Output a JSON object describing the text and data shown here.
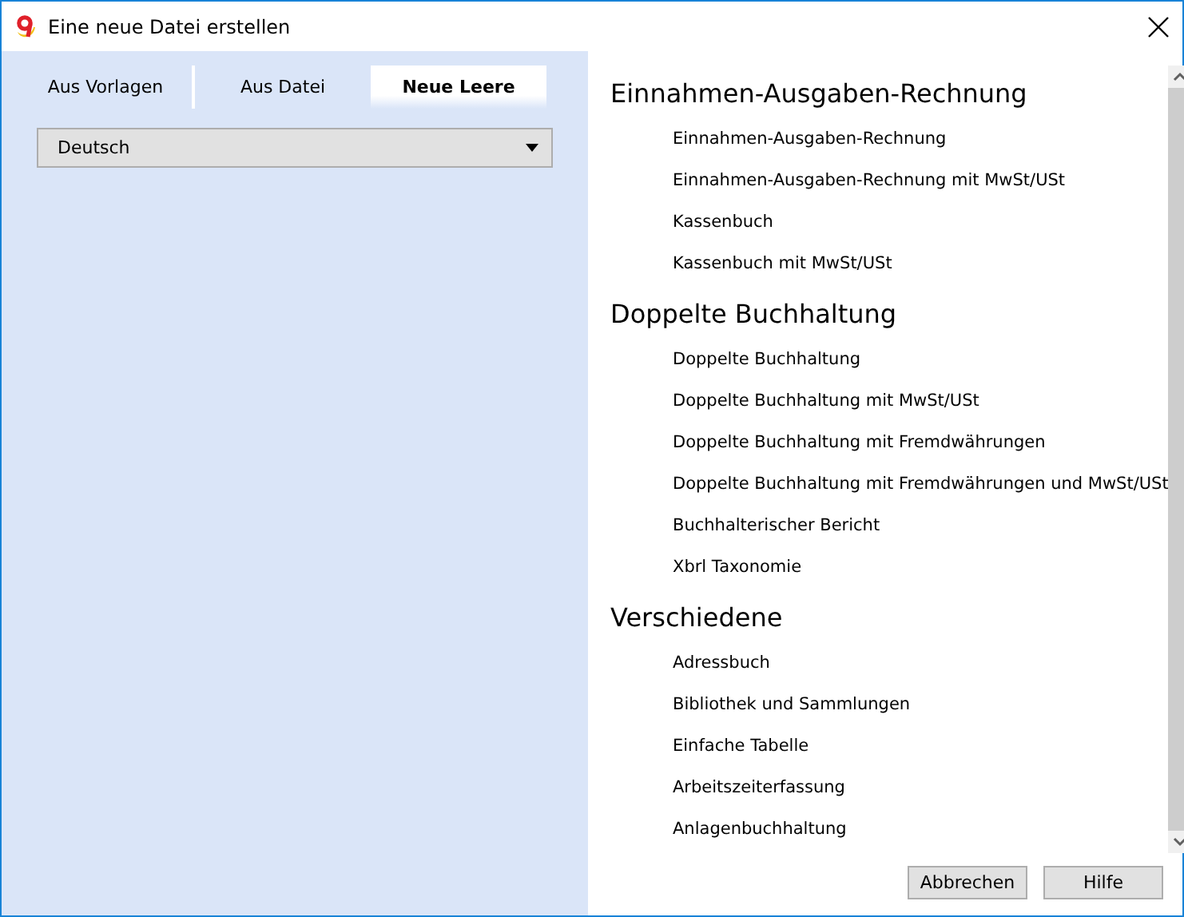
{
  "window": {
    "title": "Eine neue Datei erstellen"
  },
  "tabs": [
    {
      "label": "Aus Vorlagen",
      "selected": false
    },
    {
      "label": "Aus Datei",
      "selected": false
    },
    {
      "label": "Neue Leere",
      "selected": true
    }
  ],
  "language_select": {
    "value": "Deutsch"
  },
  "groups": [
    {
      "title": "Einnahmen-Ausgaben-Rechnung",
      "items": [
        "Einnahmen-Ausgaben-Rechnung",
        "Einnahmen-Ausgaben-Rechnung mit MwSt/USt",
        "Kassenbuch",
        "Kassenbuch mit MwSt/USt"
      ]
    },
    {
      "title": "Doppelte Buchhaltung",
      "items": [
        "Doppelte Buchhaltung",
        "Doppelte Buchhaltung mit MwSt/USt",
        "Doppelte Buchhaltung mit Fremdwährungen",
        "Doppelte Buchhaltung mit Fremdwährungen und MwSt/USt",
        "Buchhalterischer Bericht",
        "Xbrl Taxonomie"
      ]
    },
    {
      "title": "Verschiedene",
      "items": [
        "Adressbuch",
        "Bibliothek und Sammlungen",
        "Einfache Tabelle",
        "Arbeitszeiterfassung",
        "Anlagenbuchhaltung"
      ]
    }
  ],
  "buttons": [
    "Abbrechen",
    "Hilfe"
  ]
}
